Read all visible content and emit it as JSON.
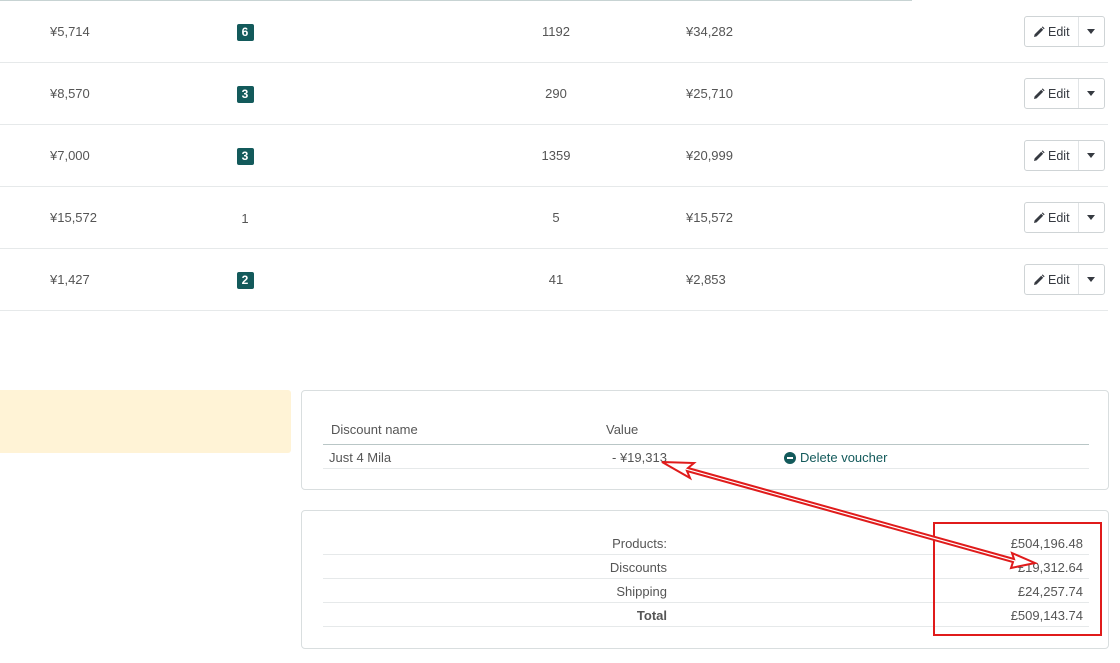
{
  "products": [
    {
      "price": "¥5,714",
      "qty": "6",
      "qty_badge": true,
      "stock": "1192",
      "total": "¥34,282"
    },
    {
      "price": "¥8,570",
      "qty": "3",
      "qty_badge": true,
      "stock": "290",
      "total": "¥25,710"
    },
    {
      "price": "¥7,000",
      "qty": "3",
      "qty_badge": true,
      "stock": "1359",
      "total": "¥20,999"
    },
    {
      "price": "¥15,572",
      "qty": "1",
      "qty_badge": false,
      "stock": "5",
      "total": "¥15,572"
    },
    {
      "price": "¥1,427",
      "qty": "2",
      "qty_badge": true,
      "stock": "41",
      "total": "¥2,853"
    }
  ],
  "row_actions": {
    "edit_label": "Edit"
  },
  "discounts": {
    "header_name": "Discount name",
    "header_value": "Value",
    "rows": [
      {
        "name": "Just 4 Mila",
        "value": "- ¥19,313",
        "delete_label": "Delete voucher"
      }
    ]
  },
  "totals": {
    "products_label": "Products:",
    "products_value": "£504,196.48",
    "discounts_label": "Discounts",
    "discounts_value": "£19,312.64",
    "shipping_label": "Shipping",
    "shipping_value": "£24,257.74",
    "total_label": "Total",
    "total_value": "£509,143.74"
  },
  "colors": {
    "accent": "#135a5b",
    "annotation": "#e01b1b",
    "warning_bg": "#fff3d6"
  }
}
